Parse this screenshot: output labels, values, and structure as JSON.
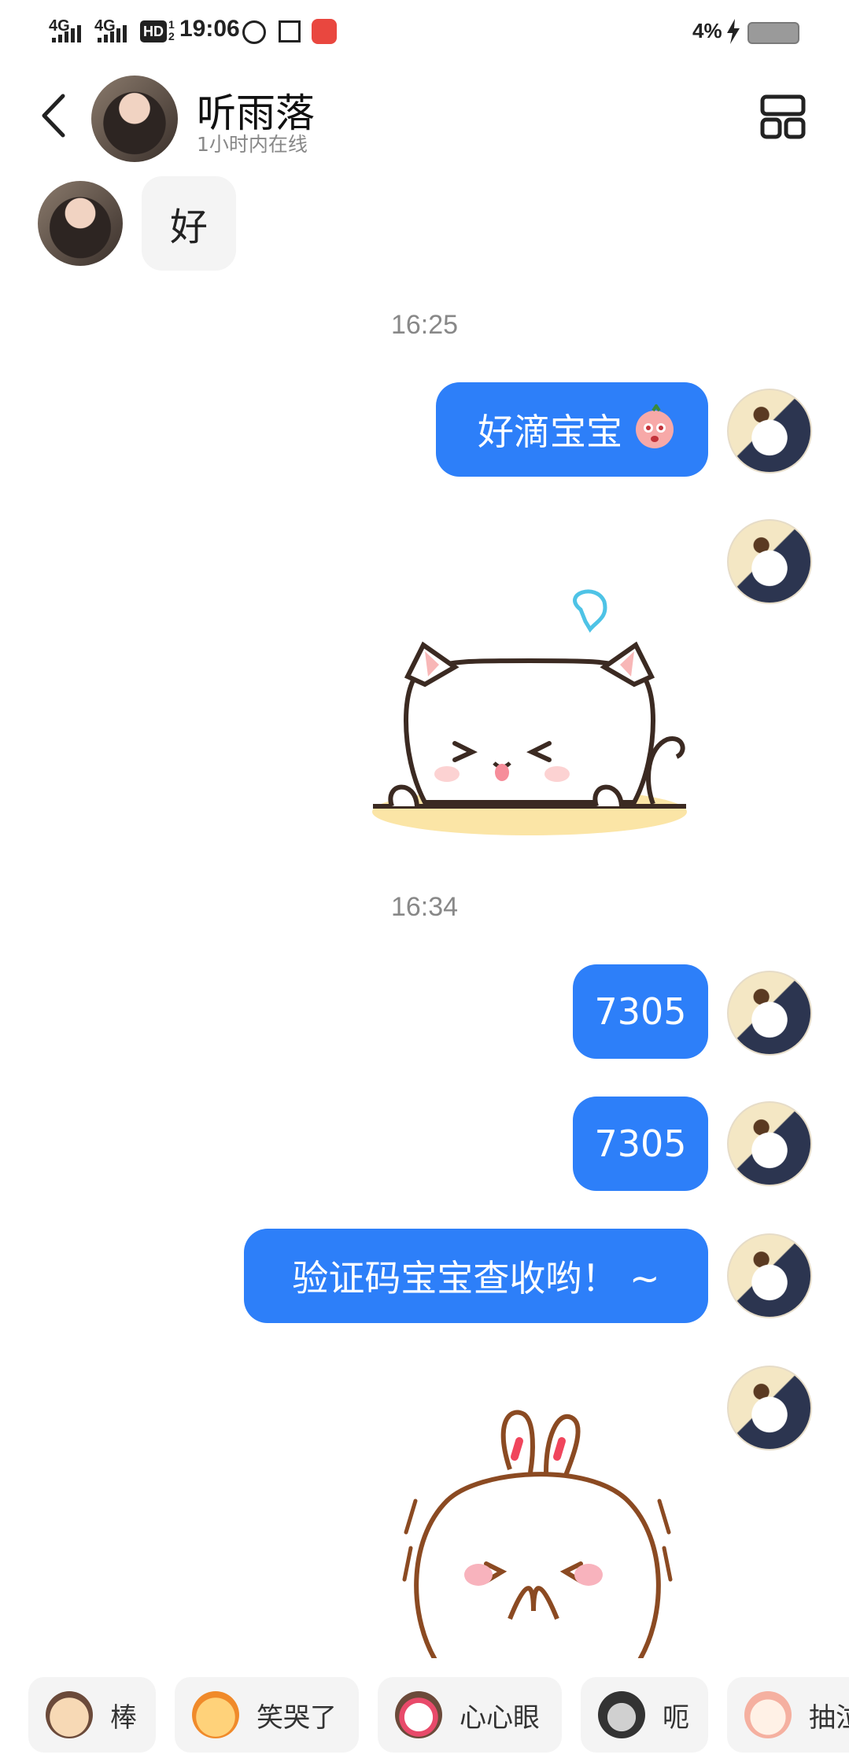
{
  "status_bar": {
    "network1": "4G",
    "network2": "4G",
    "hd": "HD",
    "hd_sub": "1 2",
    "time": "19:06",
    "battery": "4%"
  },
  "header": {
    "back_icon": "chevron-left-icon",
    "contact_name": "听雨落",
    "contact_status": "1小时内在线",
    "menu_icon": "grid-layout-icon"
  },
  "messages": {
    "incoming_text": "好",
    "ts1": "16:25",
    "out1": "好滴宝宝",
    "ts2": "16:34",
    "out2": "7305",
    "out3": "7305",
    "out4": "验证码宝宝查收哟！ ~"
  },
  "quick_reactions": [
    {
      "label": "棒"
    },
    {
      "label": "笑哭了"
    },
    {
      "label": "心心眼"
    },
    {
      "label": "呃"
    },
    {
      "label": "抽泣"
    }
  ],
  "colors": {
    "bubble_out": "#2d7ff9",
    "bubble_in": "#f4f4f4",
    "timestamp": "#888888"
  }
}
